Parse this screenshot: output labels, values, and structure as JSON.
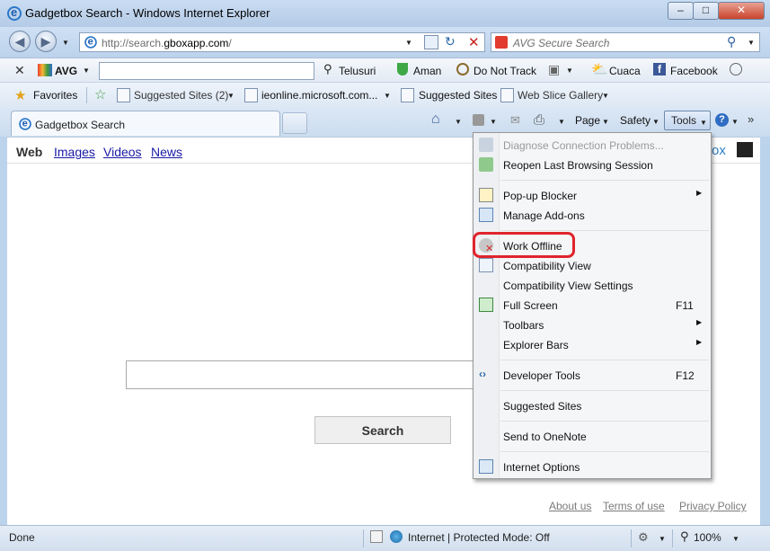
{
  "window": {
    "title": "Gadgetbox Search - Windows Internet Explorer"
  },
  "address_bar": {
    "url_prefix": "http://search.",
    "url_domain": "gboxapp.com",
    "url_suffix": "/"
  },
  "search_bar": {
    "placeholder": "AVG Secure Search"
  },
  "avg_toolbar": {
    "brand": "AVG",
    "search_button": "Telusuri",
    "safe_label": "Aman",
    "do_not_track": "Do Not Track",
    "weather": "Cuaca",
    "facebook": "Facebook"
  },
  "favorites_bar": {
    "favorites": "Favorites",
    "items": [
      {
        "label": "Suggested Sites (2)"
      },
      {
        "label": "ieonline.microsoft.com..."
      },
      {
        "label": "Suggested Sites"
      },
      {
        "label": "Web Slice Gallery"
      }
    ]
  },
  "tab": {
    "active_title": "Gadgetbox Search"
  },
  "command_bar": {
    "page": "Page",
    "safety": "Safety",
    "tools": "Tools"
  },
  "content": {
    "nav": {
      "web": "Web",
      "images": "Images",
      "videos": "Videos",
      "news": "News"
    },
    "logo_fragment": "ox",
    "search_button": "Search",
    "footer": {
      "about": "About us",
      "terms": "Terms of use",
      "privacy": "Privacy Policy"
    }
  },
  "tools_menu": {
    "items": [
      {
        "label": "Diagnose Connection Problems...",
        "disabled": true,
        "icon": "network-diagnose-icon"
      },
      {
        "label": "Reopen Last Browsing Session",
        "icon": "reopen-session-icon"
      },
      {
        "label": "Pop-up Blocker",
        "submenu": true,
        "icon": "popup-blocker-icon"
      },
      {
        "label": "Manage Add-ons",
        "icon": "addons-icon"
      },
      {
        "label": "Work Offline",
        "icon": "work-offline-icon",
        "highlighted": true
      },
      {
        "label": "Compatibility View",
        "icon": "compatibility-view-icon"
      },
      {
        "label": "Compatibility View Settings"
      },
      {
        "label": "Full Screen",
        "shortcut": "F11",
        "icon": "full-screen-icon"
      },
      {
        "label": "Toolbars",
        "submenu": true
      },
      {
        "label": "Explorer Bars",
        "submenu": true
      },
      {
        "label": "Developer Tools",
        "shortcut": "F12",
        "icon": "developer-tools-icon"
      },
      {
        "label": "Suggested Sites"
      },
      {
        "label": "Send to OneNote"
      },
      {
        "label": "Internet Options",
        "icon": "internet-options-icon"
      }
    ],
    "highlight_color": "#e0242c"
  },
  "status_bar": {
    "status": "Done",
    "zone": "Internet | Protected Mode: Off",
    "zoom": "100%"
  }
}
